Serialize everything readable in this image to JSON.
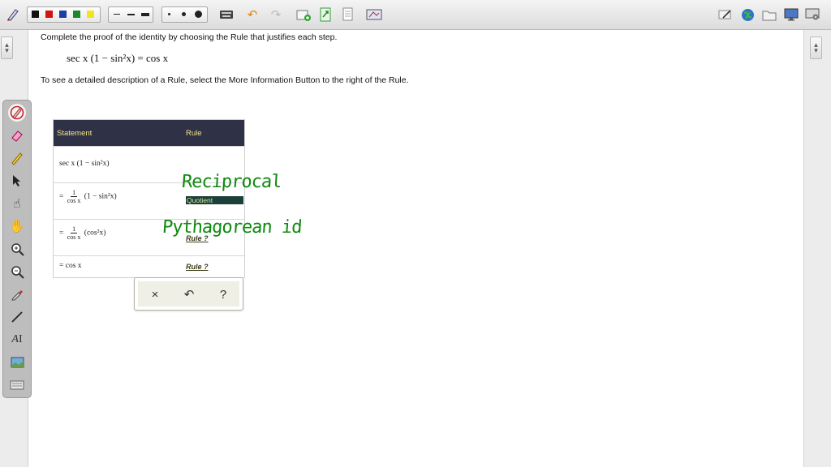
{
  "toolbar": {
    "colors": [
      "#111111",
      "#d31212",
      "#1b3fa8",
      "#1d8a2a",
      "#f2e51a"
    ],
    "icons": [
      "pen-tool-icon",
      "color-black-icon",
      "color-red-icon",
      "color-blue-icon",
      "color-green-icon",
      "color-yellow-icon",
      "line-thin-icon",
      "line-medium-icon",
      "line-thick-icon",
      "dot-small-icon",
      "dot-medium-icon",
      "dot-large-icon",
      "keyboard-icon",
      "undo-icon",
      "redo-icon",
      "new-page-icon",
      "export-icon",
      "document-icon",
      "screen-capture-icon",
      "clear-icon",
      "globe-icon",
      "folder-icon",
      "monitor-icon",
      "settings-icon"
    ]
  },
  "content": {
    "instruction_1": "Complete the proof of the identity by choosing the Rule that justifies each step.",
    "identity_lhs": "sec x (1 − sin²x)",
    "identity_rhs": "= cos x",
    "instruction_2": "To see a detailed description of a Rule, select the More Information Button to the right of the Rule."
  },
  "table": {
    "header_statement": "Statement",
    "header_rule": "Rule",
    "rows": [
      {
        "statement": "sec x (1 − sin²x)",
        "rule": ""
      },
      {
        "prefix": "=",
        "num": "1",
        "den": "cos x",
        "tail": "(1 − sin²x)",
        "rule": "Quotient"
      },
      {
        "prefix": "=",
        "num": "1",
        "den": "cos x",
        "tail": "(cos²x)",
        "rule": "Rule ?"
      },
      {
        "prefix": "=",
        "statement": "cos x",
        "rule": "Rule ?"
      }
    ]
  },
  "handwriting": {
    "note_1": "Reciprocal",
    "note_2": "Pythagorean id"
  },
  "popup": {
    "close": "×",
    "undo": "↶",
    "help": "?"
  }
}
